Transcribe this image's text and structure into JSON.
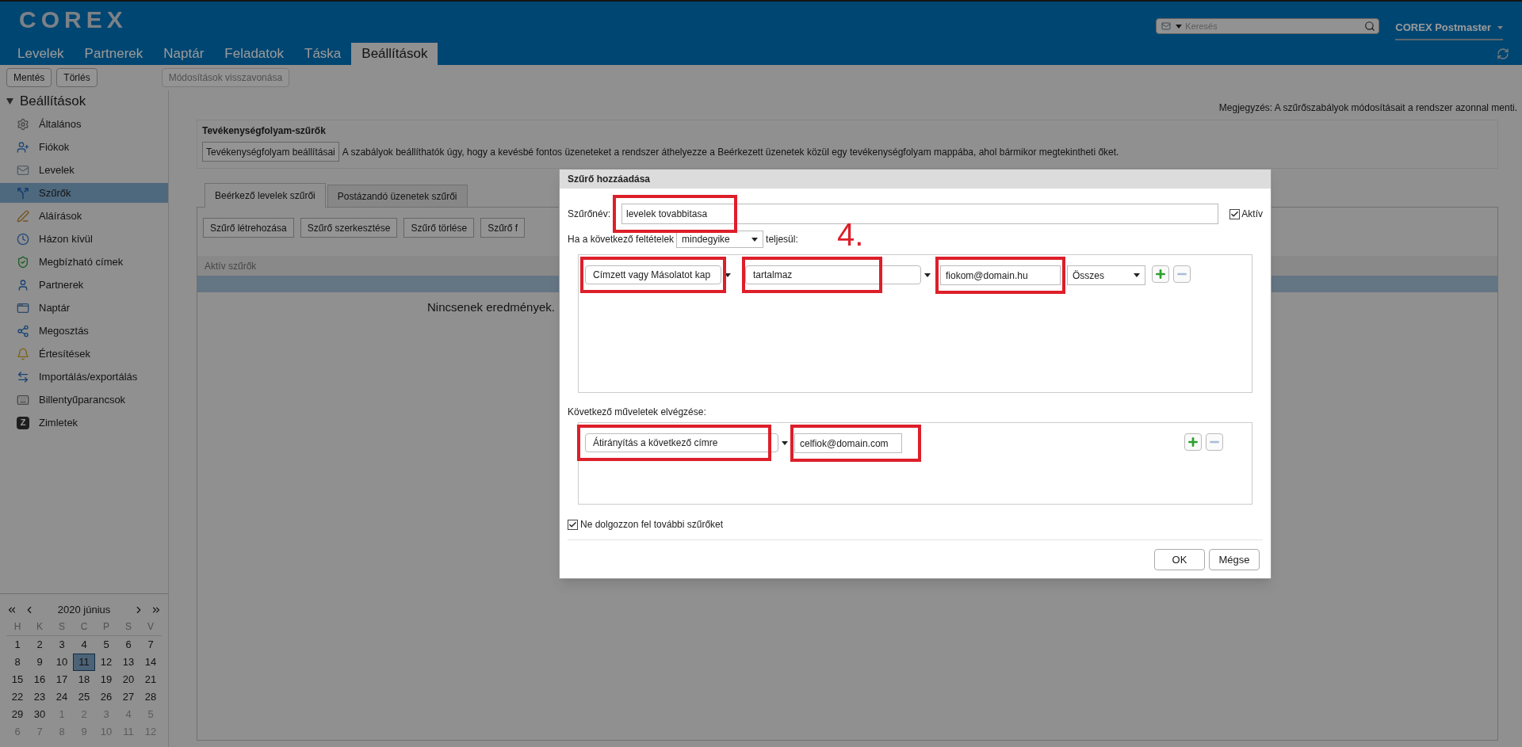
{
  "header": {
    "logo": "COREX",
    "search": {
      "placeholder": "Keresés"
    },
    "user": "COREX Postmaster"
  },
  "tabs": [
    {
      "label": "Levelek",
      "selected": false
    },
    {
      "label": "Partnerek",
      "selected": false
    },
    {
      "label": "Naptár",
      "selected": false
    },
    {
      "label": "Feladatok",
      "selected": false
    },
    {
      "label": "Táska",
      "selected": false
    },
    {
      "label": "Beállítások",
      "selected": true
    }
  ],
  "toolbar": [
    {
      "label": "Mentés",
      "disabled": false
    },
    {
      "label": "Törlés",
      "disabled": false
    },
    {
      "label": "Módosítások visszavonása",
      "disabled": true
    }
  ],
  "sidebar": {
    "title": "Beállítások",
    "expanded": true,
    "items": [
      {
        "label": "Általános",
        "selected": false
      },
      {
        "label": "Fiókok",
        "selected": false
      },
      {
        "label": "Levelek",
        "selected": false
      },
      {
        "label": "Szűrők",
        "selected": true
      },
      {
        "label": "Aláírások",
        "selected": false
      },
      {
        "label": "Házon kívül",
        "selected": false
      },
      {
        "label": "Megbízható címek",
        "selected": false
      },
      {
        "label": "Partnerek",
        "selected": false
      },
      {
        "label": "Naptár",
        "selected": false
      },
      {
        "label": "Megosztás",
        "selected": false
      },
      {
        "label": "Értesítések",
        "selected": false
      },
      {
        "label": "Importálás/exportálás",
        "selected": false
      },
      {
        "label": "Billentyűparancsok",
        "selected": false
      },
      {
        "label": "Zimletek",
        "letter": "Z",
        "selected": false
      }
    ]
  },
  "calendar": {
    "title": "2020 június",
    "weekdays": [
      "H",
      "K",
      "S",
      "C",
      "P",
      "S",
      "V"
    ],
    "weeks": [
      [
        {
          "d": "1",
          "muted": false,
          "selected": false
        },
        {
          "d": "2",
          "muted": false,
          "selected": false
        },
        {
          "d": "3",
          "muted": false,
          "selected": false
        },
        {
          "d": "4",
          "muted": false,
          "selected": false
        },
        {
          "d": "5",
          "muted": false,
          "selected": false
        },
        {
          "d": "6",
          "muted": false,
          "selected": false
        },
        {
          "d": "7",
          "muted": false,
          "selected": false
        }
      ],
      [
        {
          "d": "8",
          "muted": false,
          "selected": false
        },
        {
          "d": "9",
          "muted": false,
          "selected": false
        },
        {
          "d": "10",
          "muted": false,
          "selected": false
        },
        {
          "d": "11",
          "muted": false,
          "selected": true
        },
        {
          "d": "12",
          "muted": false,
          "selected": false
        },
        {
          "d": "13",
          "muted": false,
          "selected": false
        },
        {
          "d": "14",
          "muted": false,
          "selected": false
        }
      ],
      [
        {
          "d": "15",
          "muted": false,
          "selected": false
        },
        {
          "d": "16",
          "muted": false,
          "selected": false
        },
        {
          "d": "17",
          "muted": false,
          "selected": false
        },
        {
          "d": "18",
          "muted": false,
          "selected": false
        },
        {
          "d": "19",
          "muted": false,
          "selected": false
        },
        {
          "d": "20",
          "muted": false,
          "selected": false
        },
        {
          "d": "21",
          "muted": false,
          "selected": false
        }
      ],
      [
        {
          "d": "22",
          "muted": false,
          "selected": false
        },
        {
          "d": "23",
          "muted": false,
          "selected": false
        },
        {
          "d": "24",
          "muted": false,
          "selected": false
        },
        {
          "d": "25",
          "muted": false,
          "selected": false
        },
        {
          "d": "26",
          "muted": false,
          "selected": false
        },
        {
          "d": "27",
          "muted": false,
          "selected": false
        },
        {
          "d": "28",
          "muted": false,
          "selected": false
        }
      ],
      [
        {
          "d": "29",
          "muted": false,
          "selected": false
        },
        {
          "d": "30",
          "muted": false,
          "selected": false
        },
        {
          "d": "1",
          "muted": true,
          "selected": false
        },
        {
          "d": "2",
          "muted": true,
          "selected": false
        },
        {
          "d": "3",
          "muted": true,
          "selected": false
        },
        {
          "d": "4",
          "muted": true,
          "selected": false
        },
        {
          "d": "5",
          "muted": true,
          "selected": false
        }
      ],
      [
        {
          "d": "6",
          "muted": true,
          "selected": false
        },
        {
          "d": "7",
          "muted": true,
          "selected": false
        },
        {
          "d": "8",
          "muted": true,
          "selected": false
        },
        {
          "d": "9",
          "muted": true,
          "selected": false
        },
        {
          "d": "10",
          "muted": true,
          "selected": false
        },
        {
          "d": "11",
          "muted": true,
          "selected": false
        },
        {
          "d": "12",
          "muted": true,
          "selected": false
        }
      ]
    ]
  },
  "content": {
    "note": "Megjegyzés: A szűrőszabályok módosításait a rendszer azonnal menti.",
    "activity": {
      "title": "Tevékenységfolyam-szűrők",
      "button": "Tevékenységfolyam beállításai",
      "description": "A szabályok beállíthatók úgy, hogy a kevésbé fontos üzeneteket a rendszer áthelyezze a Beérkezett üzenetek közül egy tevékenységfolyam mappába, ahol bármikor megtekintheti őket."
    },
    "filter_tabs": [
      {
        "label": "Beérkező levelek szűrői",
        "selected": true
      },
      {
        "label": "Postázandó üzenetek szűrői",
        "selected": false
      }
    ],
    "buttons": [
      "Szűrő létrehozása",
      "Szűrő szerkesztése",
      "Szűrő törlése",
      "Szűrő f"
    ],
    "list_header": "Aktív szűrők",
    "empty": "Nincsenek eredmények."
  },
  "dialog": {
    "title": "Szűrő hozzáadása",
    "name_label": "Szűrőnév:",
    "name_value": "levelek tovabbitasa",
    "active": {
      "label": "Aktív",
      "checked": true
    },
    "match_prefix": "Ha a következő feltételek",
    "match_value": "mindegyike",
    "match_suffix": "teljesül:",
    "condition": {
      "field": "Címzett vagy Másolatot kap",
      "operator": "tartalmaz",
      "value": "fiokom@domain.hu",
      "scope": "Összes"
    },
    "actions_label": "Következő műveletek elvégzése:",
    "action": {
      "type": "Átirányítás a következő címre",
      "value": "celfiok@domain.com"
    },
    "stop": {
      "label": "Ne dolgozzon fel további szűrőket",
      "checked": true
    },
    "buttons": [
      "OK",
      "Mégse"
    ]
  },
  "annotation": {
    "step": "4."
  }
}
